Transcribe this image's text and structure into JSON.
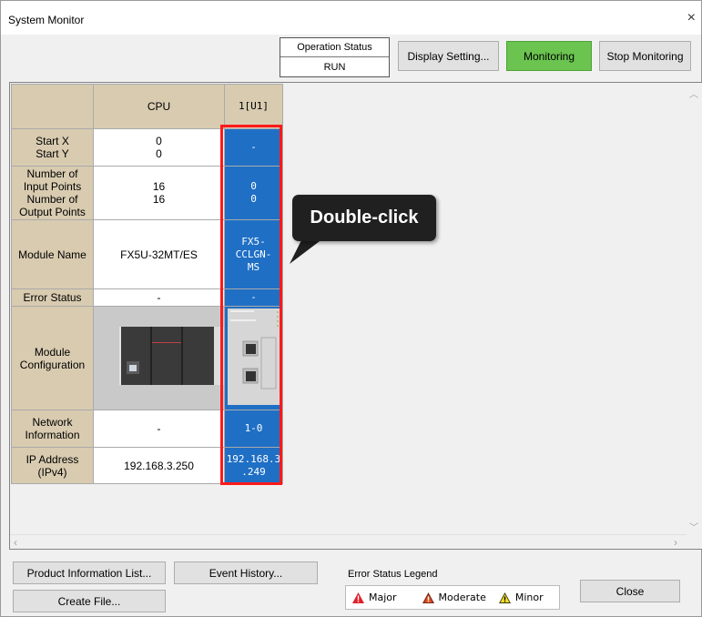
{
  "window": {
    "title": "System Monitor",
    "close_symbol": "×"
  },
  "operation_status": {
    "label": "Operation Status",
    "value": "RUN"
  },
  "toolbar": {
    "display_setting": "Display Setting...",
    "monitoring": "Monitoring",
    "stop_monitoring": "Stop Monitoring"
  },
  "table": {
    "columns": [
      "CPU",
      "1[U1]"
    ],
    "rows": {
      "start": {
        "label1": "Start X",
        "label2": "Start Y",
        "cpu1": "0",
        "cpu2": "0",
        "mod": "-"
      },
      "points": {
        "label1": "Number of",
        "label2": "Input Points",
        "label3": "Number of",
        "label4": "Output Points",
        "cpu1": "16",
        "cpu2": "16",
        "mod1": "0",
        "mod2": "0"
      },
      "module_name": {
        "label": "Module Name",
        "cpu": "FX5U-32MT/ES",
        "mod1": "FX5-",
        "mod2": "CCLGN-",
        "mod3": "MS"
      },
      "error_status": {
        "label": "Error Status",
        "cpu": "-",
        "mod": "-"
      },
      "module_config": {
        "label1": "Module",
        "label2": "Configuration"
      },
      "network": {
        "label1": "Network",
        "label2": "Information",
        "cpu": "-",
        "mod": "1-0"
      },
      "ip": {
        "label1": "IP Address",
        "label2": "(IPv4)",
        "cpu": "192.168.3.250",
        "mod1": "192.168.3",
        "mod2": ".249"
      }
    }
  },
  "annotation": {
    "text": "Double-click"
  },
  "bottom": {
    "product_info": "Product Information List...",
    "event_history": "Event History...",
    "create_file": "Create File...",
    "close": "Close",
    "legend_label": "Error Status Legend",
    "legend": {
      "major": "Major",
      "moderate": "Moderate",
      "minor": "Minor"
    }
  },
  "colors": {
    "monitoring_active": "#6ac44f",
    "selected_cell": "#1f6fc5",
    "highlight": "#ff1a1a"
  }
}
